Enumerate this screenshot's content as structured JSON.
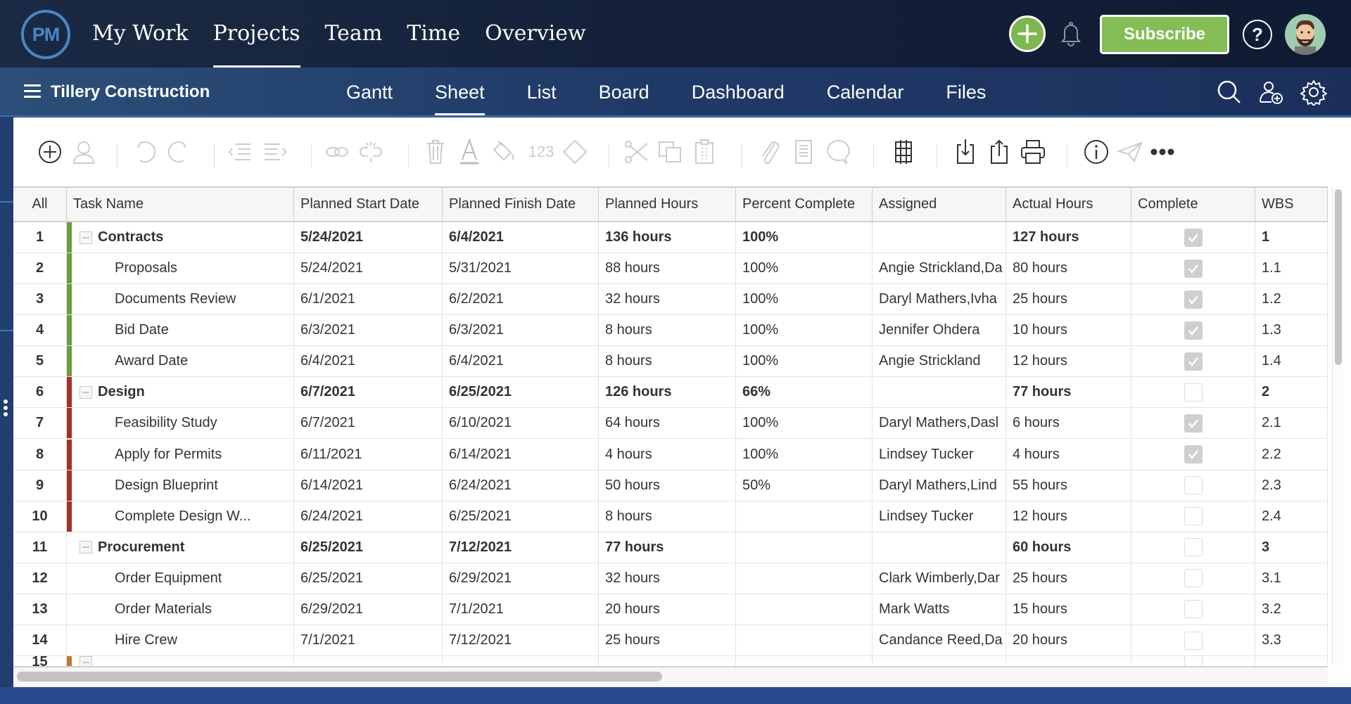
{
  "header": {
    "logo_text": "PM",
    "nav": [
      {
        "label": "My Work",
        "active": false
      },
      {
        "label": "Projects",
        "active": true
      },
      {
        "label": "Team",
        "active": false
      },
      {
        "label": "Time",
        "active": false
      },
      {
        "label": "Overview",
        "active": false
      }
    ],
    "subscribe_label": "Subscribe",
    "help_label": "?",
    "accent_color": "#7cb84f"
  },
  "subnav": {
    "project_title": "Tillery Construction",
    "views": [
      {
        "label": "Gantt",
        "active": false
      },
      {
        "label": "Sheet",
        "active": true
      },
      {
        "label": "List",
        "active": false
      },
      {
        "label": "Board",
        "active": false
      },
      {
        "label": "Dashboard",
        "active": false
      },
      {
        "label": "Calendar",
        "active": false
      },
      {
        "label": "Files",
        "active": false
      }
    ]
  },
  "toolbar": {
    "number_format_label": "123",
    "icons": [
      "add-task",
      "assign-user",
      "undo",
      "redo",
      "outdent",
      "indent",
      "link",
      "unlink",
      "delete",
      "font-color",
      "fill-color",
      "number-format",
      "milestone",
      "cut",
      "copy",
      "paste",
      "attach",
      "notes",
      "comment",
      "columns",
      "import",
      "export",
      "print",
      "info",
      "send",
      "more"
    ]
  },
  "table": {
    "columns": [
      "All",
      "Task Name",
      "Planned Start Date",
      "Planned Finish Date",
      "Planned Hours",
      "Percent Complete",
      "Assigned",
      "Actual Hours",
      "Complete",
      "WBS"
    ],
    "rows": [
      {
        "num": "1",
        "task": "Contracts",
        "summary": true,
        "color": "#6f9a3f",
        "start": "5/24/2021",
        "finish": "6/4/2021",
        "planned_hours": "136 hours",
        "percent": "100%",
        "assigned": "",
        "actual_hours": "127 hours",
        "complete": true,
        "wbs": "1"
      },
      {
        "num": "2",
        "task": "Proposals",
        "summary": false,
        "color": "#6f9a3f",
        "start": "5/24/2021",
        "finish": "5/31/2021",
        "planned_hours": "88 hours",
        "percent": "100%",
        "assigned": "Angie Strickland,Da",
        "actual_hours": "80 hours",
        "complete": true,
        "wbs": "1.1"
      },
      {
        "num": "3",
        "task": "Documents Review",
        "summary": false,
        "color": "#6f9a3f",
        "start": "6/1/2021",
        "finish": "6/2/2021",
        "planned_hours": "32 hours",
        "percent": "100%",
        "assigned": "Daryl Mathers,Ivha",
        "actual_hours": "25 hours",
        "complete": true,
        "wbs": "1.2"
      },
      {
        "num": "4",
        "task": "Bid Date",
        "summary": false,
        "color": "#6f9a3f",
        "start": "6/3/2021",
        "finish": "6/3/2021",
        "planned_hours": "8 hours",
        "percent": "100%",
        "assigned": "Jennifer Ohdera",
        "actual_hours": "10 hours",
        "complete": true,
        "wbs": "1.3"
      },
      {
        "num": "5",
        "task": "Award Date",
        "summary": false,
        "color": "#6f9a3f",
        "start": "6/4/2021",
        "finish": "6/4/2021",
        "planned_hours": "8 hours",
        "percent": "100%",
        "assigned": "Angie Strickland",
        "actual_hours": "12 hours",
        "complete": true,
        "wbs": "1.4"
      },
      {
        "num": "6",
        "task": "Design",
        "summary": true,
        "color": "#a3302a",
        "start": "6/7/2021",
        "finish": "6/25/2021",
        "planned_hours": "126 hours",
        "percent": "66%",
        "assigned": "",
        "actual_hours": "77 hours",
        "complete": false,
        "wbs": "2"
      },
      {
        "num": "7",
        "task": "Feasibility Study",
        "summary": false,
        "color": "#a3302a",
        "start": "6/7/2021",
        "finish": "6/10/2021",
        "planned_hours": "64 hours",
        "percent": "100%",
        "assigned": "Daryl Mathers,Dasl",
        "actual_hours": "6 hours",
        "complete": true,
        "wbs": "2.1"
      },
      {
        "num": "8",
        "task": "Apply for Permits",
        "summary": false,
        "color": "#a3302a",
        "start": "6/11/2021",
        "finish": "6/14/2021",
        "planned_hours": "4 hours",
        "percent": "100%",
        "assigned": "Lindsey Tucker",
        "actual_hours": "4 hours",
        "complete": true,
        "wbs": "2.2"
      },
      {
        "num": "9",
        "task": "Design Blueprint",
        "summary": false,
        "color": "#a3302a",
        "start": "6/14/2021",
        "finish": "6/24/2021",
        "planned_hours": "50 hours",
        "percent": "50%",
        "assigned": "Daryl Mathers,Lind",
        "actual_hours": "55 hours",
        "complete": false,
        "wbs": "2.3"
      },
      {
        "num": "10",
        "task": "Complete Design W...",
        "summary": false,
        "color": "#a3302a",
        "start": "6/24/2021",
        "finish": "6/25/2021",
        "planned_hours": "8 hours",
        "percent": "",
        "assigned": "Lindsey Tucker",
        "actual_hours": "12 hours",
        "complete": false,
        "wbs": "2.4"
      },
      {
        "num": "11",
        "task": "Procurement",
        "summary": true,
        "color": "",
        "start": "6/25/2021",
        "finish": "7/12/2021",
        "planned_hours": "77 hours",
        "percent": "",
        "assigned": "",
        "actual_hours": "60 hours",
        "complete": false,
        "wbs": "3"
      },
      {
        "num": "12",
        "task": "Order Equipment",
        "summary": false,
        "color": "",
        "start": "6/25/2021",
        "finish": "6/29/2021",
        "planned_hours": "32 hours",
        "percent": "",
        "assigned": "Clark Wimberly,Dar",
        "actual_hours": "25 hours",
        "complete": false,
        "wbs": "3.1"
      },
      {
        "num": "13",
        "task": "Order Materials",
        "summary": false,
        "color": "",
        "start": "6/29/2021",
        "finish": "7/1/2021",
        "planned_hours": "20 hours",
        "percent": "",
        "assigned": "Mark Watts",
        "actual_hours": "15 hours",
        "complete": false,
        "wbs": "3.2"
      },
      {
        "num": "14",
        "task": "Hire Crew",
        "summary": false,
        "color": "",
        "start": "7/1/2021",
        "finish": "7/12/2021",
        "planned_hours": "25 hours",
        "percent": "",
        "assigned": "Candance Reed,Da",
        "actual_hours": "20 hours",
        "complete": false,
        "wbs": "3.3"
      },
      {
        "num": "15",
        "task": "",
        "summary": true,
        "color": "#c07a35",
        "start": "",
        "finish": "",
        "planned_hours": "",
        "percent": "",
        "assigned": "",
        "actual_hours": "",
        "complete": false,
        "wbs": ""
      }
    ]
  }
}
